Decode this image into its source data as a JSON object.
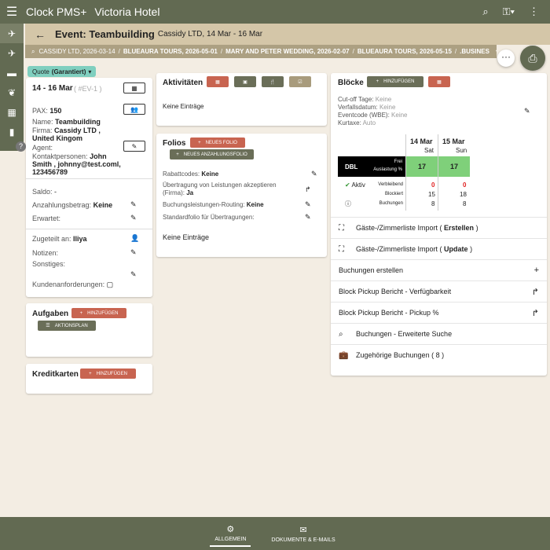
{
  "app": {
    "title": "Clock PMS+",
    "hotel": "Victoria Hotel"
  },
  "event": {
    "title": "Event: Teambuilding",
    "subtitle": "Cassidy LTD, 14 Mar - 16 Mar"
  },
  "breadcrumbs": [
    "CASSIDY LTD, 2026-03-14",
    "BLUEAURA TOURS, 2026-05-01",
    "MARY AND PETER WEDDING, 2026-02-07",
    "BLUEAURA TOURS, 2026-05-15",
    ".BUSINES"
  ],
  "status": {
    "label": "Quote",
    "value": "(Garantiert)"
  },
  "details": {
    "dates": "14 - 16 Mar",
    "event_no": "( #EV-1 )",
    "pax_label": "PAX:",
    "pax": "150",
    "name_label": "Name:",
    "name": "Teambuilding",
    "firma_label": "Firma:",
    "firma": "Cassidy LTD , United Kingom",
    "agent_label": "Agent:",
    "contacts_label": "Kontaktpersonen:",
    "contacts": "John Smith , johnny@test.coml, 123456789",
    "saldo_label": "Saldo:",
    "saldo": "-",
    "anzahlung_label": "Anzahlungsbetrag:",
    "anzahlung": "Keine",
    "erwartet_label": "Erwartet:",
    "assigned_label": "Zugeteilt an:",
    "assigned": "Iliya",
    "notizen_label": "Notizen:",
    "sonstiges_label": "Sonstiges:",
    "kunden_label": "Kundenanforderungen:"
  },
  "aufgaben": {
    "title": "Aufgaben",
    "add": "HINZUFÜGEN",
    "plan": "AKTIONSPLAN"
  },
  "kreditkarten": {
    "title": "Kreditkarten",
    "add": "HINZUFÜGEN"
  },
  "aktivitaeten": {
    "title": "Aktivitäten",
    "empty": "Keine Einträge"
  },
  "folios": {
    "title": "Folios",
    "new_folio": "NEUES FOLIO",
    "new_deposit": "NEUES ANZAHLUNGSFOLIO",
    "rabatt_label": "Rabattcodes:",
    "rabatt": "Keine",
    "uebertragung_label": "Übertragung von Leistungen akzeptieren (Firma):",
    "uebertragung": "Ja",
    "routing_label": "Buchungsleistungen-Routing:",
    "routing": "Keine",
    "standard_label": "Standardfolio für Übertragungen:",
    "empty": "Keine Einträge"
  },
  "bloecke": {
    "title": "Blöcke",
    "add": "HINZUFÜGEN",
    "cutoff_label": "Cut-off Tage:",
    "cutoff": "Keine",
    "verfall_label": "Verfallsdatum:",
    "verfall": "Keine",
    "eventcode_label": "Eventcode (WBE):",
    "eventcode": "Keine",
    "kurtaxe_label": "Kurtaxe:",
    "kurtaxe": "Auto",
    "days": [
      {
        "date": "14 Mar",
        "dow": "Sat"
      },
      {
        "date": "15 Mar",
        "dow": "Sun"
      }
    ],
    "room_type": "DBL",
    "frei_label": "Frei",
    "auslastung_label": "Auslastung %",
    "free_values": [
      "17",
      "17"
    ],
    "aktiv_label": "Aktiv",
    "verbleibend_label": "Verbleibend",
    "verbleibend": [
      "0",
      "0"
    ],
    "blockiert_label": "Blockiert",
    "blockiert": [
      "15",
      "18"
    ],
    "buchungen_label": "Buchungen",
    "buchungen": [
      "8",
      "8"
    ]
  },
  "actions": [
    {
      "label": "Gäste-/Zimmerliste Import (",
      "bold": "Erstellen",
      "tail": ")",
      "icon": "import-icon"
    },
    {
      "label": "Gäste-/Zimmerliste Import (",
      "bold": "Update",
      "tail": ")",
      "icon": "import-icon"
    },
    {
      "label": "Buchungen erstellen",
      "bold": "",
      "tail": "",
      "icon": ""
    },
    {
      "label": "Block Pickup Bericht - Verfügbarkeit",
      "bold": "",
      "tail": "",
      "icon": ""
    },
    {
      "label": "Block Pickup Bericht - Pickup %",
      "bold": "",
      "tail": "",
      "icon": ""
    },
    {
      "label": "Buchungen - Erweiterte Suche",
      "bold": "",
      "tail": "",
      "icon": "search-icon"
    },
    {
      "label": "Zugehörige Buchungen ( 8 )",
      "bold": "",
      "tail": "",
      "icon": "briefcase-icon"
    }
  ],
  "footer": {
    "tab1": "ALLGEMEIN",
    "tab2": "DOKUMENTE & E-MAILS"
  },
  "colors": {
    "primary": "#626a52",
    "header": "#d4c6a8",
    "red_button": "#c86450",
    "status": "#7fcfbf",
    "green_cell": "#7fd07a"
  }
}
